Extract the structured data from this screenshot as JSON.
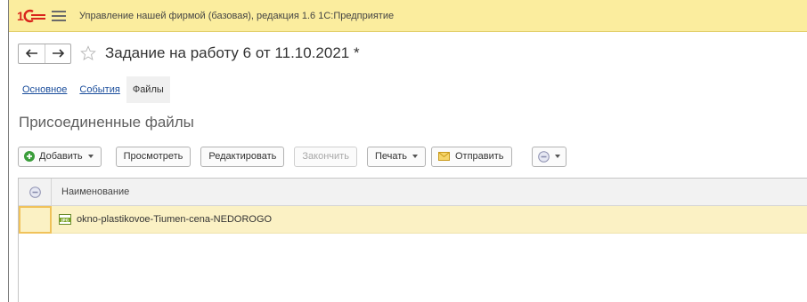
{
  "window": {
    "app_title": "Управление нашей фирмой (базовая), редакция 1.6 1С:Предприятие",
    "logo_text": "1С"
  },
  "document": {
    "title": "Задание на работу 6 от 11.10.2021 *"
  },
  "tabs": [
    {
      "label": "Основное"
    },
    {
      "label": "События"
    },
    {
      "label": "Файлы",
      "active": true
    }
  ],
  "section": {
    "title": "Присоединенные файлы"
  },
  "commands": {
    "add": "Добавить",
    "view": "Просмотреть",
    "edit": "Редактировать",
    "finish": "Закончить",
    "print": "Печать",
    "send": "Отправить"
  },
  "table": {
    "column_name": "Наименование",
    "rows": [
      {
        "name": "okno-plastikovoe-Tiumen-cena-NEDOROGO",
        "file_type": "JPG"
      }
    ]
  },
  "colors": {
    "titlebar": "#fbed9e",
    "selected_row": "#fbf1c4",
    "accent_logo": "#d9241b",
    "add_green": "#3a9d3a"
  },
  "icons": {
    "menu": "hamburger-icon",
    "back": "arrow-left-icon",
    "forward": "arrow-right-icon",
    "favorite": "star-icon",
    "add": "plus-circle-icon",
    "send": "envelope-icon",
    "more": "circle-menu-icon",
    "file": "jpg-file-icon"
  }
}
